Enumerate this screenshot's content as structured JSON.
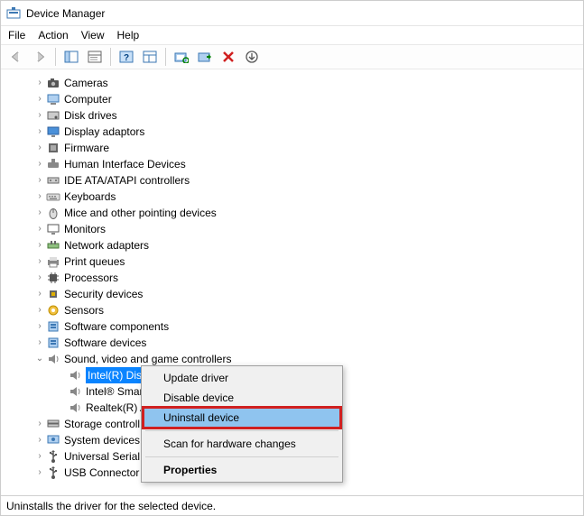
{
  "window": {
    "title": "Device Manager"
  },
  "menu": {
    "file": "File",
    "action": "Action",
    "view": "View",
    "help": "Help"
  },
  "tree": {
    "items": [
      {
        "label": "Cameras",
        "icon": "camera"
      },
      {
        "label": "Computer",
        "icon": "computer"
      },
      {
        "label": "Disk drives",
        "icon": "disk"
      },
      {
        "label": "Display adaptors",
        "icon": "display"
      },
      {
        "label": "Firmware",
        "icon": "firmware"
      },
      {
        "label": "Human Interface Devices",
        "icon": "hid"
      },
      {
        "label": "IDE ATA/ATAPI controllers",
        "icon": "ide"
      },
      {
        "label": "Keyboards",
        "icon": "keyboard"
      },
      {
        "label": "Mice and other pointing devices",
        "icon": "mouse"
      },
      {
        "label": "Monitors",
        "icon": "monitor"
      },
      {
        "label": "Network adapters",
        "icon": "network"
      },
      {
        "label": "Print queues",
        "icon": "printer"
      },
      {
        "label": "Processors",
        "icon": "processor"
      },
      {
        "label": "Security devices",
        "icon": "security"
      },
      {
        "label": "Sensors",
        "icon": "sensor"
      },
      {
        "label": "Software components",
        "icon": "software"
      },
      {
        "label": "Software devices",
        "icon": "software"
      }
    ],
    "expanded": {
      "label": "Sound, video and game controllers",
      "children": [
        {
          "label": "Intel(R) Display Audio",
          "selected": true
        },
        {
          "label": "Intel® Smar"
        },
        {
          "label": "Realtek(R) A"
        }
      ]
    },
    "after": [
      {
        "label": "Storage controll",
        "icon": "storage"
      },
      {
        "label": "System devices",
        "icon": "system"
      },
      {
        "label": "Universal Serial",
        "icon": "usb"
      },
      {
        "label": "USB Connector",
        "icon": "usb"
      }
    ]
  },
  "context_menu": {
    "update": "Update driver",
    "disable": "Disable device",
    "uninstall": "Uninstall device",
    "scan": "Scan for hardware changes",
    "properties": "Properties"
  },
  "status": {
    "text": "Uninstalls the driver for the selected device."
  }
}
